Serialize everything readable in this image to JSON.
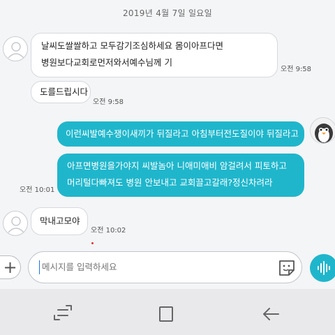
{
  "date_header": "2019년 4월 7일 일요일",
  "messages": [
    {
      "side": "in",
      "lines": [
        "날씨도쌀쌀하고 모두감기조심하세요 몸이아프다면",
        "병원보다교회로먼저와서예수님께 기"
      ],
      "time": "오전 9:58"
    },
    {
      "side": "in",
      "lines": [
        "도를드립시다"
      ],
      "time": "오전 9:58"
    },
    {
      "side": "out",
      "lines": [
        "이런씨발예수쟁이새끼가 뒤질라고 아침부터전도질이야 뒤질라고"
      ]
    },
    {
      "side": "out",
      "lines": [
        "아프면병원을가야지 씨발놈아 니애미애비 암걸려서 피토하고",
        "머리털다빠져도 병원 안보내고 교회끌고갈래?정신차려라"
      ],
      "time": "오전 10:01"
    },
    {
      "side": "in",
      "lines": [
        "막내고모야"
      ],
      "time": "오전 10:02"
    }
  ],
  "composer": {
    "placeholder": "메시지를 입력하세요"
  },
  "icons": {
    "add": "plus-icon",
    "emoji": "sticker-icon",
    "voice": "voice-wave-icon",
    "nav_recent": "recent-apps-icon",
    "nav_home": "home-icon",
    "nav_back": "back-icon",
    "avatar": "default-avatar-icon",
    "my_avatar": "penguin-avatar-icon"
  },
  "colors": {
    "outgoing_bubble": "#1fb6cc",
    "incoming_bubble": "#ffffff",
    "background": "#f4f5f7",
    "nav_bar": "#e9e9ec"
  }
}
